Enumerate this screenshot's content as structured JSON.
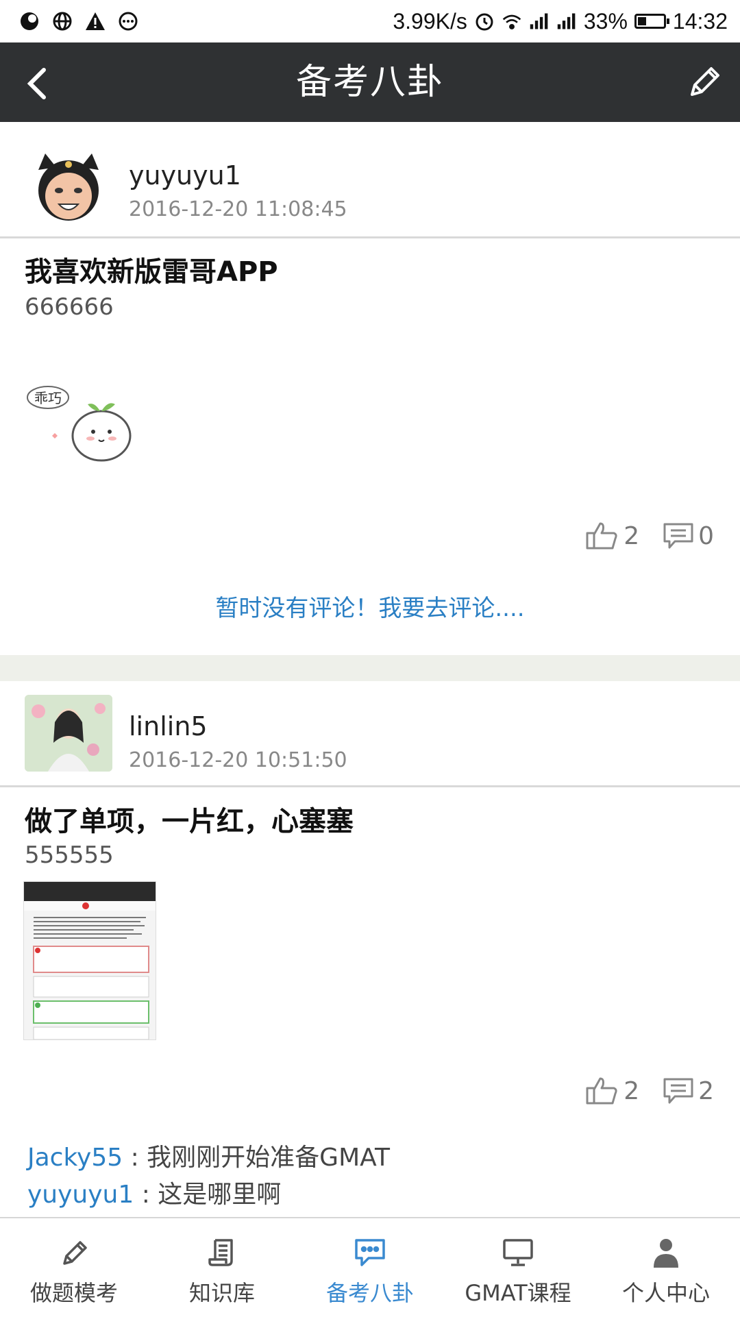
{
  "status_bar": {
    "net_speed": "3.99K/s",
    "battery": "33%",
    "time": "14:32"
  },
  "header": {
    "title": "备考八卦",
    "back_icon": "chevron-left-icon",
    "edit_icon": "pencil-icon"
  },
  "posts": [
    {
      "username": "yuyuyu1",
      "timestamp": "2016-12-20 11:08:45",
      "title": "我喜欢新版雷哥APP",
      "body": "666666",
      "image": "sticker-乖巧",
      "sticker_text": "乖巧",
      "likes": "2",
      "comments_count": "0",
      "no_comment_text": "暂时没有评论！我要去评论...."
    },
    {
      "username": "linlin5",
      "timestamp": "2016-12-20 10:51:50",
      "title": "做了单项，一片红，心塞塞",
      "body": "555555",
      "image": "screenshot-thumbnail",
      "likes": "2",
      "comments_count": "2",
      "comments": [
        {
          "user": "Jacky55",
          "sep": " : ",
          "text": "我刚刚开始准备GMAT"
        },
        {
          "user": "yuyuyu1",
          "sep": " : ",
          "text": "这是哪里啊"
        }
      ]
    }
  ],
  "tabs": [
    {
      "label": "做题模考",
      "icon": "pencil-icon",
      "active": false
    },
    {
      "label": "知识库",
      "icon": "scroll-icon",
      "active": false
    },
    {
      "label": "备考八卦",
      "icon": "chat-icon",
      "active": true
    },
    {
      "label": "GMAT课程",
      "icon": "monitor-icon",
      "active": false
    },
    {
      "label": "个人中心",
      "icon": "person-icon",
      "active": false
    }
  ],
  "colors": {
    "header_bg": "#2f3133",
    "accent": "#3a8ad0",
    "link": "#2a7fc4"
  }
}
